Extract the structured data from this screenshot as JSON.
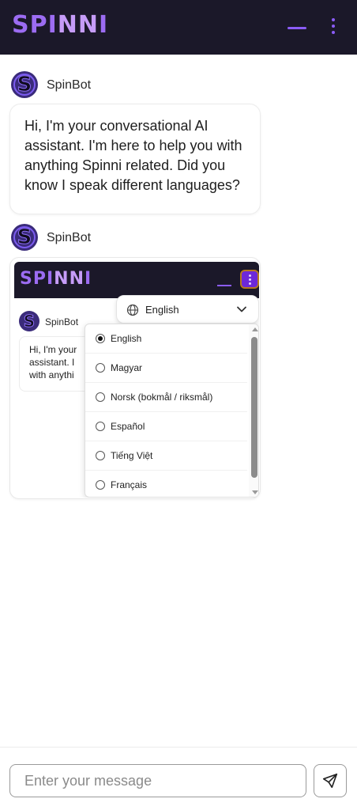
{
  "header": {
    "logo_left": "SPI",
    "logo_nn": "NN",
    "logo_right": "I",
    "accent": "#8b5cf6",
    "background": "#1b1829"
  },
  "bot": {
    "avatar_letter": "S",
    "name": "SpinBot"
  },
  "messages": [
    {
      "sender": "SpinBot",
      "text": "Hi, I'm your conversational AI assistant. I'm here to help you with anything Spinni related. Did you know I speak different languages?"
    },
    {
      "sender": "SpinBot",
      "type": "image"
    }
  ],
  "embedded_screenshot": {
    "logo_left": "SPI",
    "logo_nn": "NN",
    "logo_right": "I",
    "bot_name": "SpinBot",
    "bubble_lines": [
      "Hi, I'm your",
      "assistant. I",
      "with anythi"
    ],
    "language_select": {
      "selected": "English",
      "icon": "globe-icon",
      "options": [
        {
          "label": "English",
          "checked": true
        },
        {
          "label": "Magyar",
          "checked": false
        },
        {
          "label": "Norsk (bokmål / riksmål)",
          "checked": false
        },
        {
          "label": "Español",
          "checked": false
        },
        {
          "label": "Tiếng Việt",
          "checked": false
        },
        {
          "label": "Français",
          "checked": false
        }
      ]
    }
  },
  "composer": {
    "placeholder": "Enter your message",
    "value": "",
    "send_icon": "send-icon"
  }
}
